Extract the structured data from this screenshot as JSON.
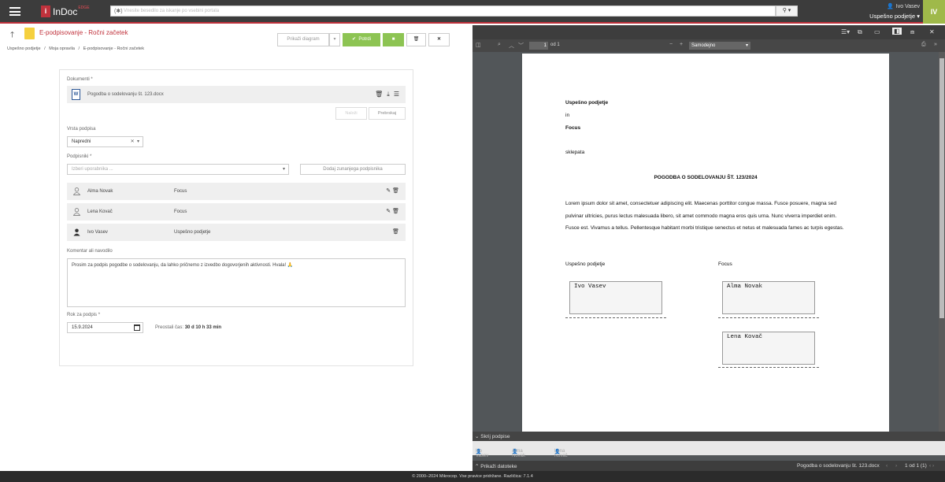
{
  "header": {
    "logo_text": "InDoc",
    "logo_edge": "EDGE",
    "search_placeholder": "Vnesite besedilo za iskanje po vsebini portala",
    "user_name": "Ivo Vasev",
    "company": "Uspešno podjetje",
    "avatar": "IV"
  },
  "page": {
    "title": "E-podpisovanje - Ročni začetek",
    "breadcrumbs": [
      "Uspešno podjetje",
      "Moja opravila",
      "E-podpisovanje - Ročni začetek"
    ],
    "toolbar": {
      "diagram": "Prikaži diagram",
      "confirm": "Potrdi"
    }
  },
  "form": {
    "documents_label": "Dokumenti *",
    "document_name": "Pogodba o sodelovanju št. 123.docx",
    "upload_btn": "Naloži",
    "browse_btn": "Prebrskaj",
    "sign_type_label": "Vrsta podpisa",
    "sign_type_value": "Napredni",
    "signers_label": "Podpisniki *",
    "signers_placeholder": "Izberi uporabnika ...",
    "add_external": "Dodaj zunanjega podpisnika",
    "signers": [
      {
        "name": "Alma Novak",
        "org": "Focus"
      },
      {
        "name": "Lena Kovač",
        "org": "Focus"
      },
      {
        "name": "Ivo Vasev",
        "org": "Uspešno podjetje"
      }
    ],
    "comment_label": "Komentar ali navodilo",
    "comment": "Prosim za podpis pogodbe o sodelovanju, da lahko pričnemo z izvedbo dogovorjenih aktivnosti. Hvala! 🙏",
    "deadline_label": "Rok za podpis *",
    "deadline": "15.9.2024",
    "remaining_label": "Preostali čas:",
    "remaining": "30 d 10 h 33 min"
  },
  "viewer": {
    "page_num": "1",
    "page_of": "od 1",
    "zoom": "Samodejno",
    "doc": {
      "party1": "Uspešno podjetje",
      "and": "in",
      "party2": "Focus",
      "conclude": "sklepata",
      "title": "POGODBA O SODELOVANJU ŠT. 123/2024",
      "body": "Lorem ipsum dolor sit amet, consectetuer adipiscing elit. Maecenas porttitor congue massa. Fusce posuere, magna sed pulvinar ultricies, purus lectus malesuada libero, sit amet commodo magna eros quis urna. Nunc viverra imperdiet enim. Fusce est. Vivamus a tellus. Pellentesque habitant morbi tristique senectus et netus et malesuada fames ac turpis egestas.",
      "col1": "Uspešno podjetje",
      "col2": "Focus",
      "sig1": "Ivo Vasev",
      "sig2": "Alma Novak",
      "sig3": "Lena Kovač"
    },
    "hide_signatures": "Skrij podpise",
    "strip": [
      "Ivo Vasev",
      "Alma Novak",
      "Lena Kovač"
    ],
    "show_files": "Prikaži datoteke",
    "filename": "Pogodba o sodelovanju št. 123.docx",
    "pager": "1 od 1 (1)"
  },
  "footer": "© 2000–2024 Mikrocop. Vse pravice pridržane.  Različica: 7.1.4"
}
